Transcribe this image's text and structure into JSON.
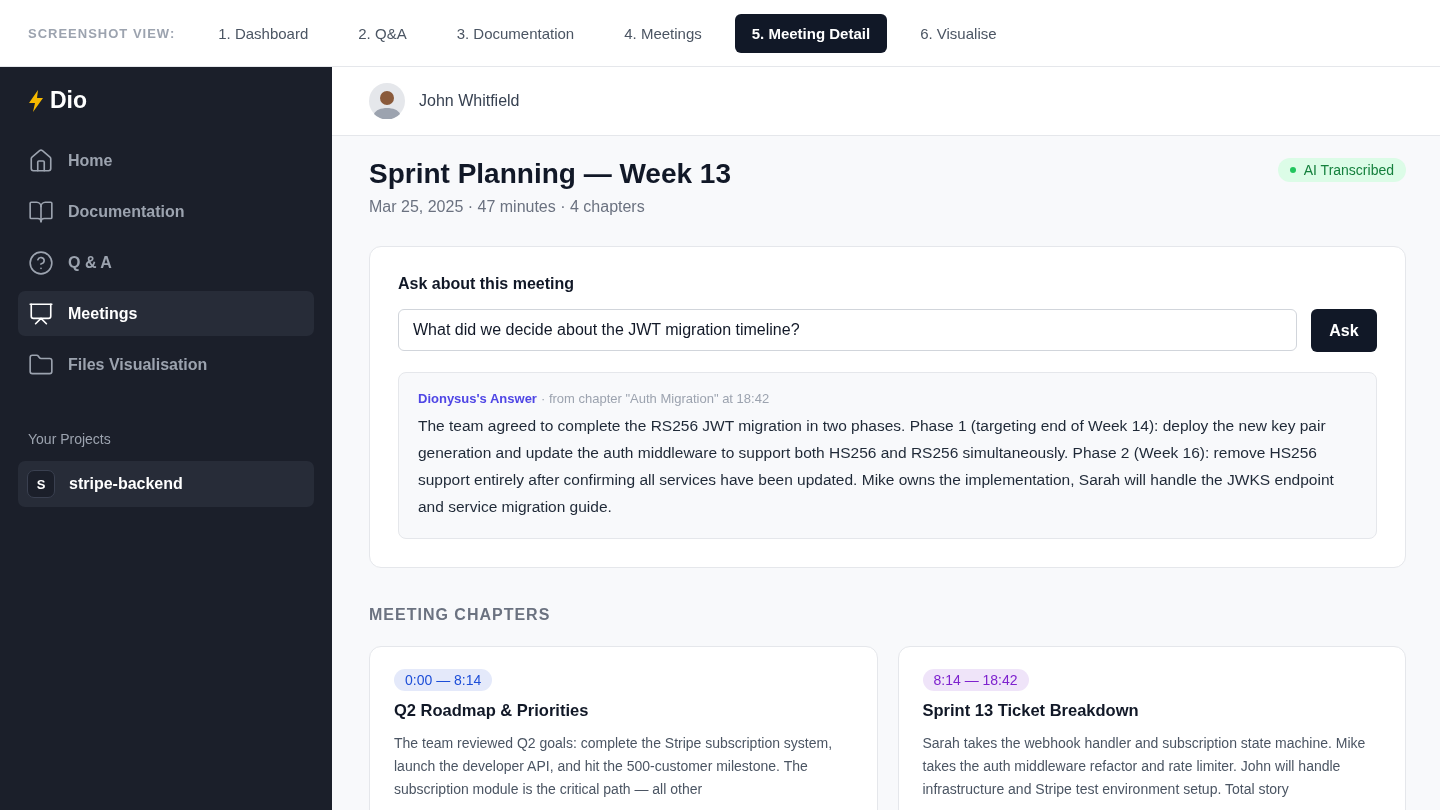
{
  "screenshot_nav": {
    "label": "SCREENSHOT VIEW:",
    "tabs": [
      {
        "label": "1. Dashboard",
        "selected": false
      },
      {
        "label": "2. Q&A",
        "selected": false
      },
      {
        "label": "3. Documentation",
        "selected": false
      },
      {
        "label": "4. Meetings",
        "selected": false
      },
      {
        "label": "5. Meeting Detail",
        "selected": true
      },
      {
        "label": "6. Visualise",
        "selected": false
      }
    ]
  },
  "sidebar": {
    "logo": "Dio",
    "items": [
      {
        "label": "Home",
        "kind": "home",
        "selected": false
      },
      {
        "label": "Documentation",
        "kind": "book",
        "selected": false
      },
      {
        "label": "Q & A",
        "kind": "question",
        "selected": false
      },
      {
        "label": "Meetings",
        "kind": "meetings",
        "selected": true
      },
      {
        "label": "Files Visualisation",
        "kind": "folder",
        "selected": false
      }
    ],
    "projects_heading": "Your Projects",
    "projects": [
      {
        "initial": "S",
        "name": "stripe-backend",
        "selected": true
      }
    ]
  },
  "header": {
    "user_name": "John Whitfield"
  },
  "meeting": {
    "title": "Sprint Planning — Week 13",
    "meta": "Mar 25, 2025 · 47 minutes · 4 chapters",
    "badge": "AI Transcribed"
  },
  "ask": {
    "heading": "Ask about this meeting",
    "value": "What did we decide about the JWT migration timeline?",
    "button": "Ask",
    "answer": {
      "author": "Dionysus's Answer",
      "source": "· from chapter \"Auth Migration\" at 18:42",
      "text": "The team agreed to complete the RS256 JWT migration in two phases. Phase 1 (targeting end of Week 14): deploy the new key pair generation and update the auth middleware to support both HS256 and RS256 simultaneously. Phase 2 (Week 16): remove HS256 support entirely after confirming all services have been updated. Mike owns the implementation, Sarah will handle the JWKS endpoint and service migration guide."
    }
  },
  "chapters": {
    "heading": "MEETING CHAPTERS",
    "items": [
      {
        "time": "0:00 — 8:14",
        "color": "#1d4ed8",
        "title": "Q2 Roadmap & Priorities",
        "summary": "The team reviewed Q2 goals: complete the Stripe subscription system, launch the developer API, and hit the 500-customer milestone. The subscription module is the critical path — all other"
      },
      {
        "time": "8:14 — 18:42",
        "color": "#7e22ce",
        "title": "Sprint 13 Ticket Breakdown",
        "summary": "Sarah takes the webhook handler and subscription state machine. Mike takes the auth middleware refactor and rate limiter. John will handle infrastructure and Stripe test environment setup. Total story"
      }
    ]
  }
}
